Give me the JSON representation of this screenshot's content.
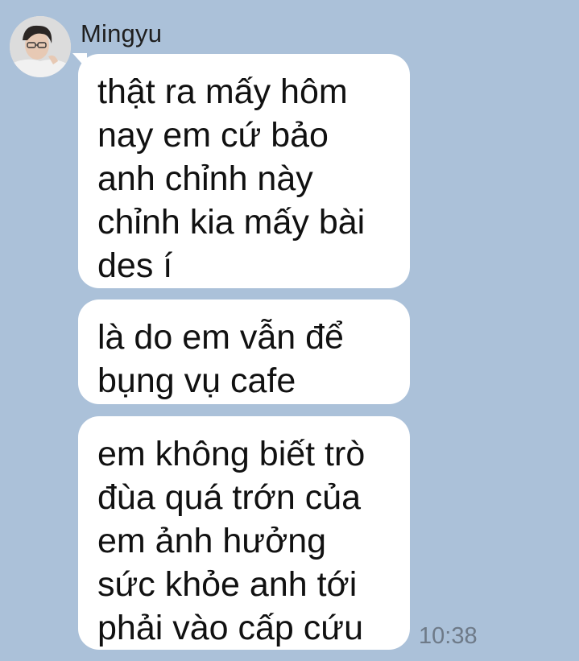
{
  "chat": {
    "sender_name": "Mingyu",
    "messages": [
      {
        "lines": [
          "thật ra mấy hôm",
          "nay em cứ bảo",
          "anh chỉnh này",
          "chỉnh kia mấy bài",
          "des í"
        ]
      },
      {
        "lines": [
          "là do em vẫn để",
          "bụng vụ cafe"
        ]
      },
      {
        "lines": [
          "em không biết trò",
          "đùa quá trớn của",
          "em ảnh hưởng",
          "sức khỏe anh tới",
          "phải vào cấp cứu"
        ]
      }
    ],
    "timestamp": "10:38"
  },
  "colors": {
    "background": "#abc1d9",
    "bubble": "#ffffff",
    "text": "#111111",
    "timestamp": "#6e7a88"
  }
}
